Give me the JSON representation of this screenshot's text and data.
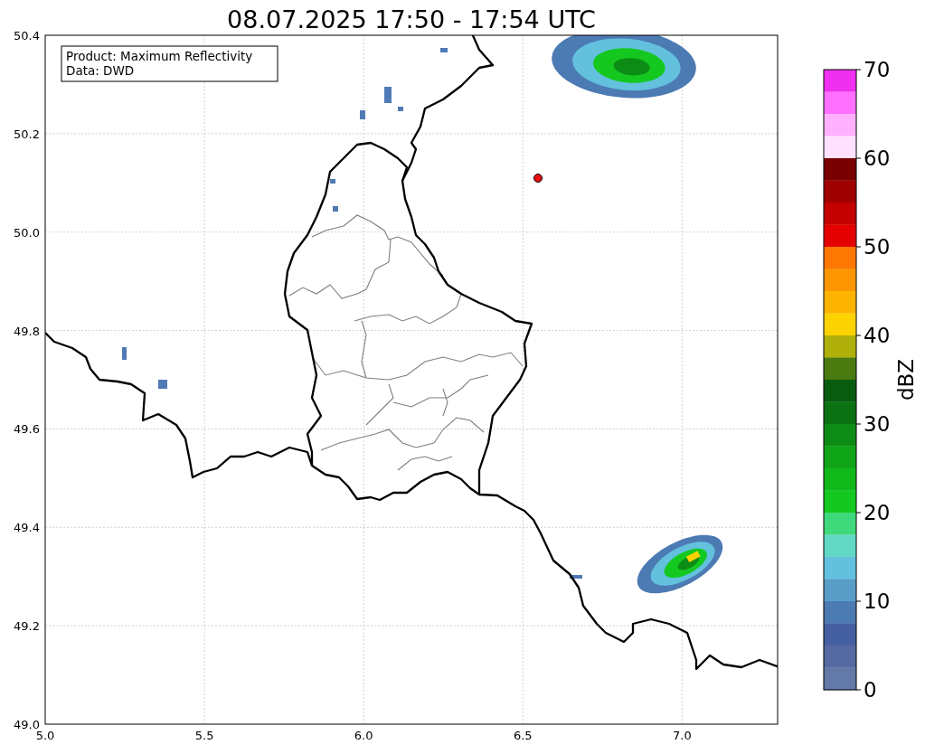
{
  "title": "08.07.2025 17:50 - 17:54 UTC",
  "info_box": [
    "Product: Maximum Reflectivity",
    "Data: DWD"
  ],
  "x_ticks": [
    "5.0",
    "5.5",
    "6.0",
    "6.5",
    "7.0"
  ],
  "y_ticks": [
    "50.4",
    "50.2",
    "50.0",
    "49.8",
    "49.6",
    "49.4",
    "49.2",
    "49.0"
  ],
  "colorbar": {
    "label": "dBZ",
    "ticks": [
      "70",
      "60",
      "50",
      "40",
      "30",
      "20",
      "10",
      "0"
    ],
    "segments": [
      {
        "color": "#f030f0"
      },
      {
        "color": "#ff70ff"
      },
      {
        "color": "#ffb0ff"
      },
      {
        "color": "#ffe0ff"
      },
      {
        "color": "#780000"
      },
      {
        "color": "#a00000"
      },
      {
        "color": "#c40000"
      },
      {
        "color": "#e40000"
      },
      {
        "color": "#fc7800"
      },
      {
        "color": "#fc9600"
      },
      {
        "color": "#fcb400"
      },
      {
        "color": "#fcd200"
      },
      {
        "color": "#b0b00a"
      },
      {
        "color": "#4a7a10"
      },
      {
        "color": "#085c10"
      },
      {
        "color": "#0a7212"
      },
      {
        "color": "#0c8c15"
      },
      {
        "color": "#10a419"
      },
      {
        "color": "#10b81a"
      },
      {
        "color": "#14c820"
      },
      {
        "color": "#3fd87a"
      },
      {
        "color": "#63d9c5"
      },
      {
        "color": "#63c1de"
      },
      {
        "color": "#5a9ec8"
      },
      {
        "color": "#4c7ab3"
      },
      {
        "color": "#4560a1"
      },
      {
        "color": "#566aa2"
      },
      {
        "color": "#6379a7"
      }
    ]
  }
}
